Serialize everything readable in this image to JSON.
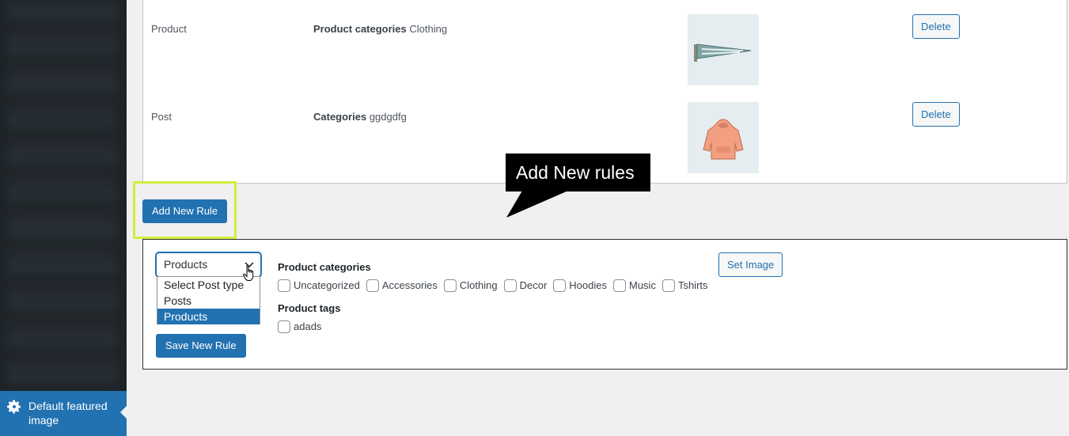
{
  "sidebar": {
    "active_item": {
      "label": "Default featured image",
      "icon": "gear-icon"
    }
  },
  "rules": [
    {
      "post_type": "Product",
      "taxonomy_label": "Product categories",
      "term": "Clothing",
      "thumbnail": "pennant-image",
      "delete_label": "Delete"
    },
    {
      "post_type": "Post",
      "taxonomy_label": "Categories",
      "term": "ggdgdfg",
      "thumbnail": "hoodie-image",
      "delete_label": "Delete"
    }
  ],
  "add_rule_button": "Add New Rule",
  "callout": {
    "text": "Add New rules"
  },
  "new_rule_form": {
    "post_type_select": {
      "value": "Products",
      "options": [
        "Select Post type",
        "Posts",
        "Products"
      ],
      "selected_index": 2
    },
    "product_categories": {
      "title": "Product categories",
      "items": [
        "Uncategorized",
        "Accessories",
        "Clothing",
        "Decor",
        "Hoodies",
        "Music",
        "Tshirts"
      ]
    },
    "product_tags": {
      "title": "Product tags",
      "items": [
        "adads"
      ]
    },
    "set_image_label": "Set Image",
    "save_label": "Save New Rule"
  },
  "colors": {
    "primary": "#2271b1",
    "sidebar_bg": "#1d2327",
    "highlight": "#d4ec3a",
    "page_bg": "#f0f0f1"
  }
}
